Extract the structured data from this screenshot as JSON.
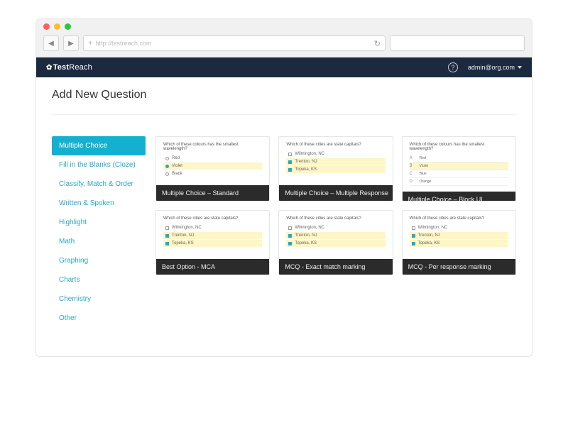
{
  "browser": {
    "url": "http://testreach.com"
  },
  "header": {
    "brand_bold": "Test",
    "brand_light": "Reach",
    "user": "admin@org.com"
  },
  "page": {
    "title": "Add New Question"
  },
  "sidebar": {
    "items": [
      {
        "label": "Multiple Choice",
        "active": true
      },
      {
        "label": "Fill in the Blanks (Cloze)"
      },
      {
        "label": "Classify, Match & Order"
      },
      {
        "label": "Written & Spoken"
      },
      {
        "label": "Highlight"
      },
      {
        "label": "Math"
      },
      {
        "label": "Graphing"
      },
      {
        "label": "Charts"
      },
      {
        "label": "Chemistry"
      },
      {
        "label": "Other"
      }
    ]
  },
  "cards": [
    {
      "label": "Multiple Choice – Standard",
      "question": "Which of these colours has the smallest wavelength?",
      "type": "radio",
      "options": [
        {
          "text": "Red",
          "hl": false,
          "sel": false
        },
        {
          "text": "Violet",
          "hl": true,
          "sel": true
        },
        {
          "text": "Black",
          "hl": false,
          "sel": false
        }
      ]
    },
    {
      "label": "Multiple Choice – Multiple Response",
      "question": "Which of these cities are state capitals?",
      "type": "check",
      "options": [
        {
          "text": "Wilmington, NC",
          "hl": false,
          "sel": false
        },
        {
          "text": "Trenton, NJ",
          "hl": true,
          "sel": true
        },
        {
          "text": "Topeka, KS",
          "hl": true,
          "sel": true
        }
      ]
    },
    {
      "label": "Multiple Choice – Block UI",
      "question": "Which of these colours has the smallest wavelength?",
      "type": "block",
      "options": [
        {
          "letter": "A",
          "text": "Red",
          "hl": false
        },
        {
          "letter": "B",
          "text": "Violet",
          "hl": true
        },
        {
          "letter": "C",
          "text": "Blue",
          "hl": false
        },
        {
          "letter": "D",
          "text": "Orange",
          "hl": false
        }
      ]
    },
    {
      "label": "Best Option - MCA",
      "question": "Which of these cities are state capitals?",
      "type": "check",
      "options": [
        {
          "text": "Wilmington, NC",
          "hl": false,
          "sel": false
        },
        {
          "text": "Trenton, NJ",
          "hl": true,
          "sel": true
        },
        {
          "text": "Topeka, KS",
          "hl": true,
          "sel": true
        }
      ]
    },
    {
      "label": "MCQ - Exact match marking",
      "question": "Which of these cities are state capitals?",
      "type": "check",
      "options": [
        {
          "text": "Wilmington, NC",
          "hl": false,
          "sel": false
        },
        {
          "text": "Trenton, NJ",
          "hl": true,
          "sel": true
        },
        {
          "text": "Topeka, KS",
          "hl": true,
          "sel": true
        }
      ]
    },
    {
      "label": "MCQ - Per response marking",
      "question": "Which of these cities are state capitals?",
      "type": "check",
      "options": [
        {
          "text": "Wilmington, NC",
          "hl": false,
          "sel": false
        },
        {
          "text": "Trenton, NJ",
          "hl": true,
          "sel": true
        },
        {
          "text": "Topeka, KS",
          "hl": true,
          "sel": true
        }
      ]
    }
  ]
}
